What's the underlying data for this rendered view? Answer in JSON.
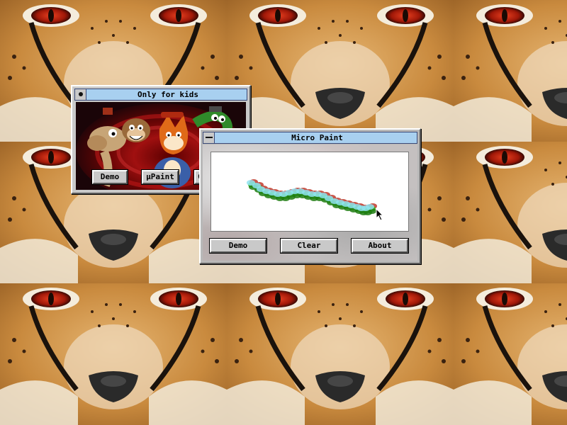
{
  "desktop": {
    "wallpaper": "cheetah-face-tiles"
  },
  "kids_window": {
    "title": "Only for kids",
    "buttons": [
      "Demo",
      "μPaint",
      "C"
    ]
  },
  "paint_window": {
    "title": "Micro Paint",
    "buttons": [
      "Demo",
      "Clear",
      "About"
    ]
  },
  "colors": {
    "titlebar": "#a8d0f0",
    "window": "#c9c9c9",
    "stroke_green": "#2fbf1a",
    "stroke_red": "#c0392b",
    "stroke_cyan": "#8fe3f0"
  },
  "icons": {
    "kids_sysmenu": "circle-dot-icon",
    "paint_sysmenu": "dash-icon",
    "cursor": "arrow-cursor-icon"
  }
}
